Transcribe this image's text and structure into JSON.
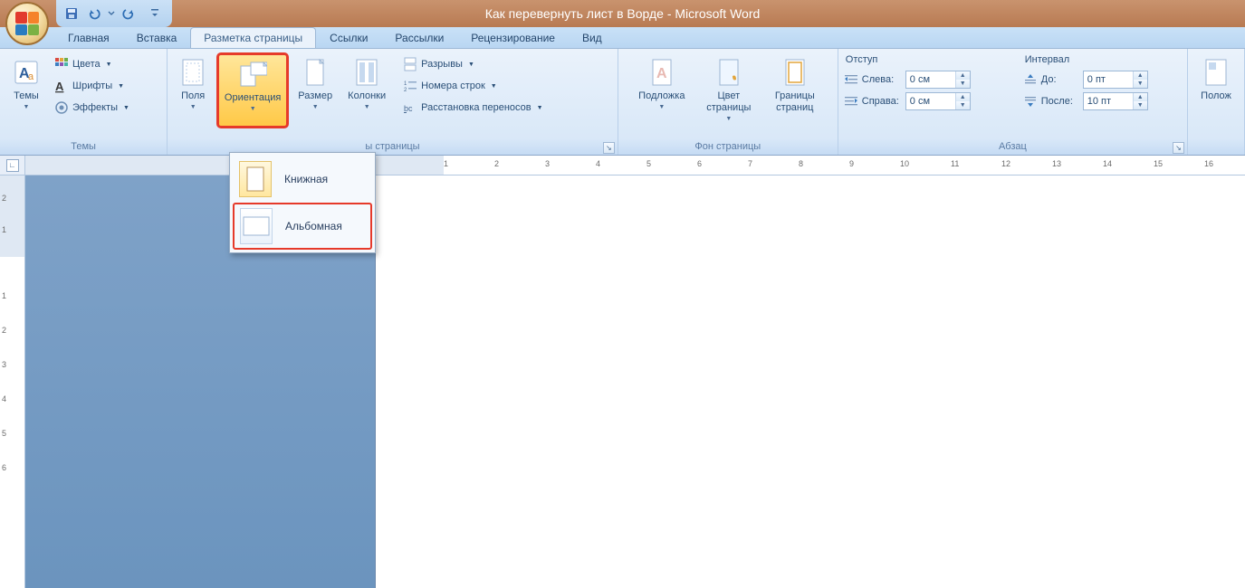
{
  "title": "Как перевернуть лист в Ворде - Microsoft Word",
  "tabs": [
    "Главная",
    "Вставка",
    "Разметка страницы",
    "Ссылки",
    "Рассылки",
    "Рецензирование",
    "Вид"
  ],
  "active_tab": 2,
  "groups": {
    "themes": {
      "label": "Темы",
      "themes_btn": "Темы",
      "colors": "Цвета",
      "fonts": "Шрифты",
      "effects": "Эффекты"
    },
    "page_setup": {
      "label": "ы страницы",
      "margins": "Поля",
      "orientation": "Ориентация",
      "size": "Размер",
      "columns": "Колонки",
      "breaks": "Разрывы",
      "line_numbers": "Номера строк",
      "hyphenation": "Расстановка переносов"
    },
    "page_bg": {
      "label": "Фон страницы",
      "watermark": "Подложка",
      "page_color": "Цвет страницы",
      "borders": "Границы страниц"
    },
    "paragraph": {
      "label": "Абзац",
      "indent_title": "Отступ",
      "left": "Слева:",
      "right": "Справа:",
      "spacing_title": "Интервал",
      "before": "До:",
      "after": "После:",
      "val_left": "0 см",
      "val_right": "0 см",
      "val_before": "0 пт",
      "val_after": "10 пт"
    },
    "arrange": {
      "position": "Полож"
    }
  },
  "orientation_menu": {
    "portrait": "Книжная",
    "landscape": "Альбомная"
  },
  "ruler_h": [
    1,
    2,
    3,
    4,
    5,
    6,
    7,
    8,
    9,
    10,
    11,
    12,
    13,
    14,
    15,
    16
  ],
  "ruler_v_top": [
    "2",
    "1"
  ],
  "ruler_v": [
    1,
    2,
    3,
    4,
    5,
    6
  ]
}
